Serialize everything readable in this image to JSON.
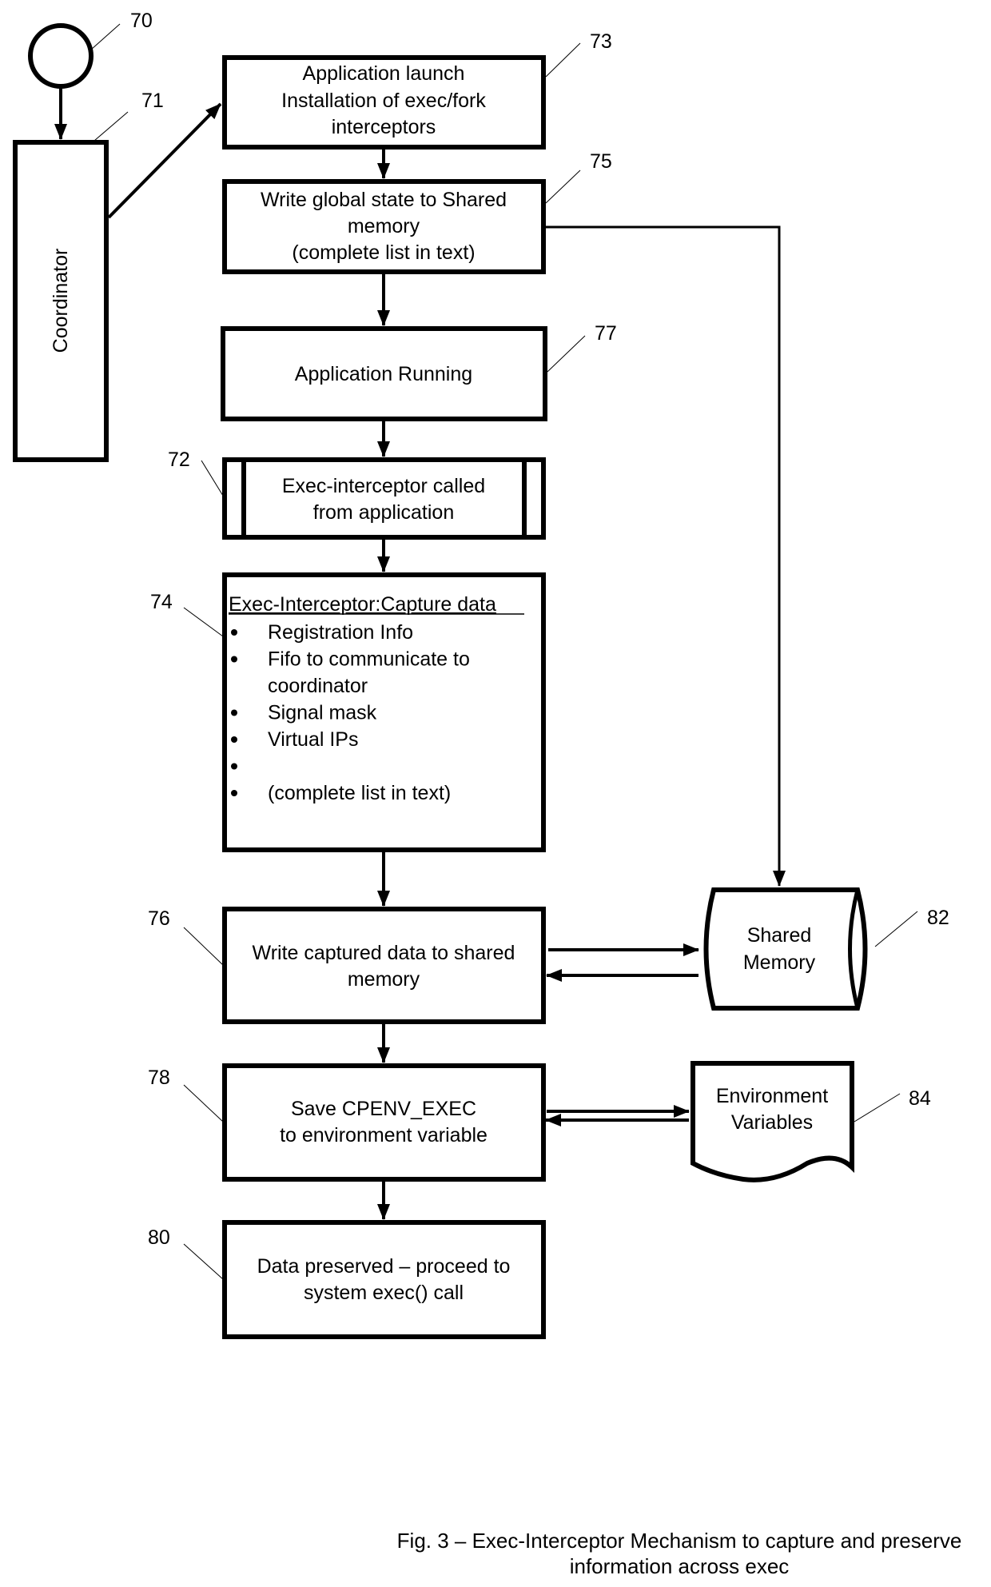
{
  "diagram": {
    "start_ref": "70",
    "coordinator": {
      "ref": "71",
      "label": "Coordinator"
    },
    "steps": {
      "launch": {
        "ref": "73",
        "lines": [
          "Application launch",
          "Installation of exec/fork",
          "interceptors"
        ]
      },
      "write_global": {
        "ref": "75",
        "lines": [
          "Write global state to Shared",
          "memory",
          "(complete list in text)"
        ]
      },
      "running": {
        "ref": "77",
        "lines": [
          "Application Running"
        ]
      },
      "exec_called": {
        "ref": "72",
        "lines": [
          "Exec-interceptor called",
          "from application"
        ]
      },
      "capture": {
        "ref": "74",
        "title": "Exec-Interceptor:Capture data",
        "bullets": [
          "Registration Info",
          "Fifo to communicate to",
          "coordinator",
          "Signal mask",
          "Virtual IPs",
          "",
          "(complete list in text)"
        ],
        "bullet_marks": [
          true,
          true,
          false,
          true,
          true,
          true,
          true
        ]
      },
      "write_captured": {
        "ref": "76",
        "lines": [
          "Write captured data to shared",
          "memory"
        ]
      },
      "save_env": {
        "ref": "78",
        "lines": [
          "Save CPENV_EXEC",
          "to environment variable"
        ]
      },
      "preserved": {
        "ref": "80",
        "lines": [
          "Data preserved – proceed to",
          "system exec() call"
        ]
      }
    },
    "stores": {
      "shared_memory": {
        "ref": "82",
        "lines": [
          "Shared",
          "Memory"
        ]
      },
      "env_vars": {
        "ref": "84",
        "lines": [
          "Environment",
          "Variables"
        ]
      }
    },
    "caption": [
      "Fig. 3 – Exec-Interceptor Mechanism to capture and preserve",
      "information across exec"
    ]
  }
}
